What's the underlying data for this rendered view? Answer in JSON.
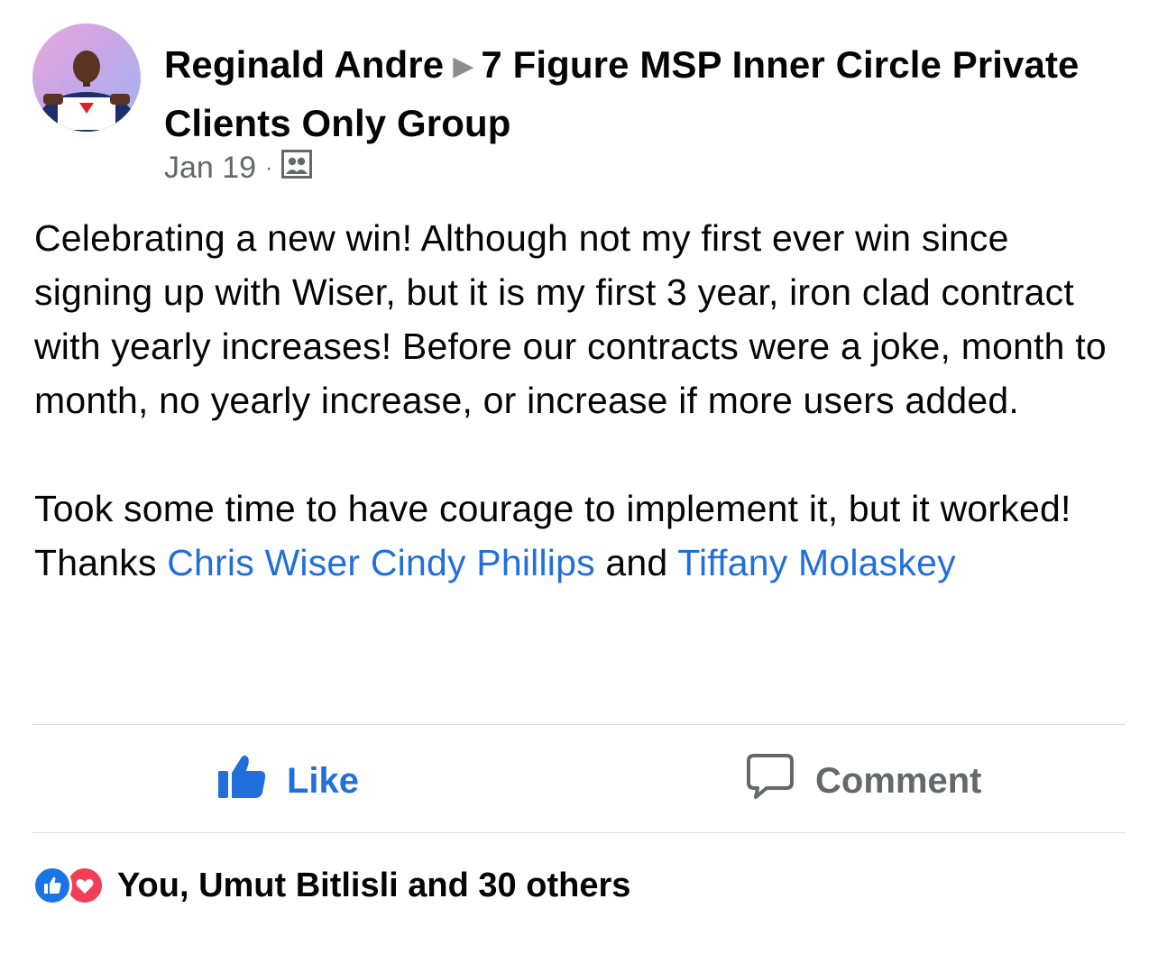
{
  "post": {
    "author": "Reginald Andre",
    "group": "7 Figure MSP Inner Circle Private Clients Only Group",
    "date": "Jan 19",
    "separator": "·",
    "audience_icon": "group-icon",
    "body_paragraph_1": "Celebrating a new win! Although not my first ever win since signing up with Wiser, but it is my first 3 year, iron clad contract with yearly increases! Before our contracts were a joke, month to month, no yearly increase, or increase if more users added.",
    "body_paragraph_2_text": "Took some time to have courage to implement it, but it worked! Thanks ",
    "mentions": [
      "Chris Wiser",
      "Cindy Phillips",
      "Tiffany Molaskey"
    ],
    "and_word": " and "
  },
  "actions": {
    "like_label": "Like",
    "comment_label": "Comment"
  },
  "reactions": {
    "summary": "You, Umut Bitlisli and 30 others",
    "icons": [
      "like-icon",
      "love-icon"
    ]
  },
  "colors": {
    "link": "#216fdb",
    "like_accent": "#1b74e4",
    "love": "#f33e58",
    "secondary_text": "#65676b"
  }
}
